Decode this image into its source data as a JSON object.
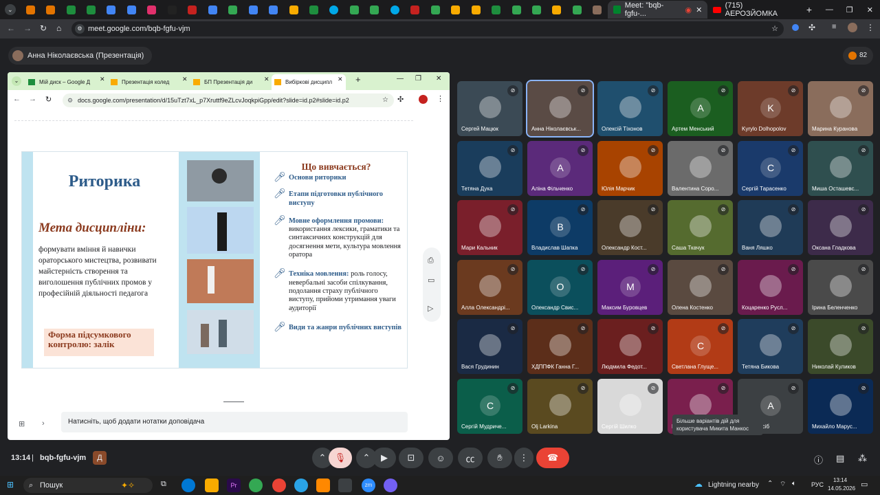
{
  "browser": {
    "tabs_titles": [
      "Meet: \"bqb-fgfu-...",
      "(715) АЕРОЗЙОМКА"
    ],
    "url": "meet.google.com/bqb-fgfu-vjm"
  },
  "meet": {
    "presenter_label": "Анна Ніколаєвська (Презентація)",
    "participant_count": "82",
    "time": "13:14",
    "meeting_code": "bqb-fgfu-vjm",
    "tooltip": "Більше варіантів дій для користувача Микита Манкос",
    "more_label": "Ще 46 осіб"
  },
  "shared_window": {
    "tabs": [
      "Мій диск – Google Д",
      "Презентація колед",
      "БП Презентація ди",
      "Вибіркові дисципл"
    ],
    "url": "docs.google.com/presentation/d/15uTzt7xL_p7Xruttf9eZLcvJoqkpiGpp/edit?slide=id.p2#slide=id.p2",
    "speaker_notes_placeholder": "Натисніть, щоб додати нотатки доповідача"
  },
  "slide": {
    "title": "Риторика",
    "goal_heading": "Мета дисципліни:",
    "goal_text": "формувати вміння й навички ораторського мистецтва, розвивати майстерність створення та виголошення публічних промов у професійній діяльності педагога",
    "control_form": "Форма підсумкового контролю: залік",
    "studied_heading": "Що вивчається?",
    "items": [
      {
        "bold": "Основи риторики",
        "rest": ""
      },
      {
        "bold": "Етапи підготовки публічного виступу",
        "rest": ""
      },
      {
        "bold": "Мовне оформлення промови:",
        "rest": " використання лексики, граматики та синтаксичних конструкцій для досягнення мети, культура мовлення оратора"
      },
      {
        "bold": "Техніка мовлення:",
        "rest": " роль голосу, невербальні засоби спілкування, подолання страху публічного виступу, прийоми утримання уваги аудиторії"
      },
      {
        "bold": "Види та жанри публічних виступів",
        "rest": ""
      }
    ]
  },
  "participants": [
    {
      "name": "Сергей Мацюк",
      "color": "#3b4a55",
      "letter": ""
    },
    {
      "name": "Анна Ніколаєвськ...",
      "color": "#5a4b45",
      "letter": ""
    },
    {
      "name": "Олексій Тіхонов",
      "color": "#1f4f6e",
      "letter": ""
    },
    {
      "name": "Артем Менський",
      "color": "#1b5e20",
      "letter": "A"
    },
    {
      "name": "Kyrylo Dolhopolov",
      "color": "#6d3b2a",
      "letter": "K"
    },
    {
      "name": "Марина Куранова",
      "color": "#8a6d5c",
      "letter": ""
    },
    {
      "name": "Тетяна Дука",
      "color": "#1a3d5c",
      "letter": ""
    },
    {
      "name": "Аліна Фільченко",
      "color": "#5b2a7a",
      "letter": "A"
    },
    {
      "name": "Юлія Марчик",
      "color": "#a84300",
      "letter": ""
    },
    {
      "name": "Валентина Соро...",
      "color": "#6b6b6b",
      "letter": ""
    },
    {
      "name": "Сергій Тарасенко",
      "color": "#1a3a6b",
      "letter": "C"
    },
    {
      "name": "Миша Осташевс...",
      "color": "#2f4f4f",
      "letter": ""
    },
    {
      "name": "Мари Кальник",
      "color": "#7a1f2b",
      "letter": ""
    },
    {
      "name": "Владислав Шапка",
      "color": "#0d3b66",
      "letter": "B"
    },
    {
      "name": "Олександр Кост...",
      "color": "#4a3b2a",
      "letter": ""
    },
    {
      "name": "Саша Ткачук",
      "color": "#556b2f",
      "letter": ""
    },
    {
      "name": "Ваня Ляшко",
      "color": "#1f3b57",
      "letter": ""
    },
    {
      "name": "Оксана Гладкова",
      "color": "#3d2b4a",
      "letter": ""
    },
    {
      "name": "Алла Олександрі...",
      "color": "#6b3a1f",
      "letter": ""
    },
    {
      "name": "Олександр Свис...",
      "color": "#0b4f5c",
      "letter": "O"
    },
    {
      "name": "Максим Буровцев",
      "color": "#5b1f7a",
      "letter": "M"
    },
    {
      "name": "Олена Костенко",
      "color": "#5a4a40",
      "letter": ""
    },
    {
      "name": "Коцаренко Русл...",
      "color": "#6a1b4d",
      "letter": ""
    },
    {
      "name": "Ірина Беленченко",
      "color": "#4a4a4a",
      "letter": ""
    },
    {
      "name": "Вася Грудинин",
      "color": "#1a2a44",
      "letter": ""
    },
    {
      "name": "ХДППФК Ганна Г...",
      "color": "#5c2e1a",
      "letter": ""
    },
    {
      "name": "Людмила Федот...",
      "color": "#6b1f1f",
      "letter": ""
    },
    {
      "name": "Светлана Глуще...",
      "color": "#b23b16",
      "letter": "C"
    },
    {
      "name": "Тетяна Бикова",
      "color": "#1f3d5c",
      "letter": ""
    },
    {
      "name": "Николай Куликов",
      "color": "#3b4a2a",
      "letter": ""
    },
    {
      "name": "Сергій Мудриче...",
      "color": "#0b5e4a",
      "letter": "C"
    },
    {
      "name": "Olj Larkina",
      "color": "#5a4a20",
      "letter": ""
    },
    {
      "name": "Сергій Шилко",
      "color": "#d9d9d9",
      "letter": ""
    },
    {
      "name": "Микита Манкос",
      "color": "#7a1f4d",
      "letter": ""
    },
    {
      "name": "Ще 46 осіб",
      "color": "#3c4043",
      "letter": "A"
    },
    {
      "name": "Михайло Марус...",
      "color": "#0b2a55",
      "letter": ""
    }
  ],
  "taskbar": {
    "search": "Пошук",
    "weather": "Lightning nearby",
    "lang": "РУС",
    "time": "13:14",
    "date": "14.05.2026"
  },
  "colors": {
    "bg": "#202124",
    "slide_blue": "#2e5c8a",
    "slide_brown": "#8b3a1e",
    "end_call": "#ea4335",
    "mic_off": "#f6d5d2"
  }
}
